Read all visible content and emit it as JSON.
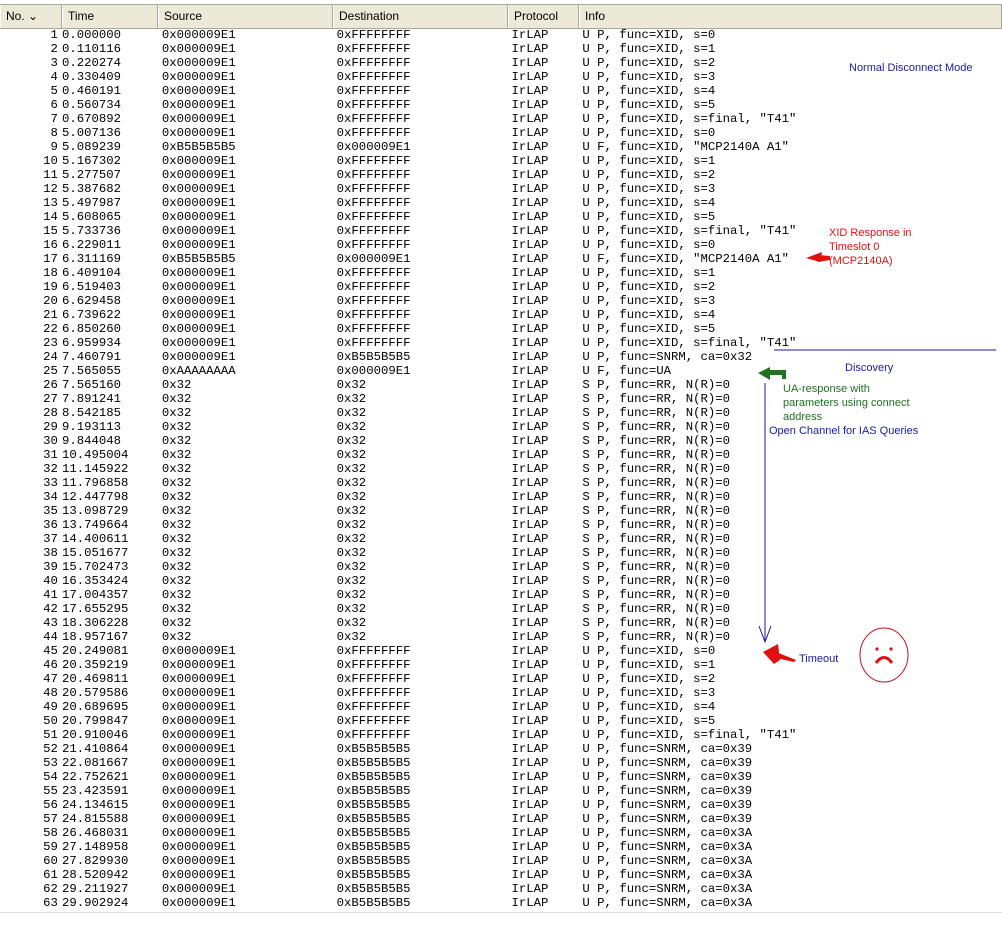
{
  "columns": [
    "No. ⌄",
    "Time",
    "Source",
    "Destination",
    "Protocol",
    "Info"
  ],
  "packets": [
    [
      "1",
      "0.000000",
      "0x000009E1",
      "0xFFFFFFFF",
      "IrLAP",
      "U P, func=XID, s=0"
    ],
    [
      "2",
      "0.110116",
      "0x000009E1",
      "0xFFFFFFFF",
      "IrLAP",
      "U P, func=XID, s=1"
    ],
    [
      "3",
      "0.220274",
      "0x000009E1",
      "0xFFFFFFFF",
      "IrLAP",
      "U P, func=XID, s=2"
    ],
    [
      "4",
      "0.330409",
      "0x000009E1",
      "0xFFFFFFFF",
      "IrLAP",
      "U P, func=XID, s=3"
    ],
    [
      "5",
      "0.460191",
      "0x000009E1",
      "0xFFFFFFFF",
      "IrLAP",
      "U P, func=XID, s=4"
    ],
    [
      "6",
      "0.560734",
      "0x000009E1",
      "0xFFFFFFFF",
      "IrLAP",
      "U P, func=XID, s=5"
    ],
    [
      "7",
      "0.670892",
      "0x000009E1",
      "0xFFFFFFFF",
      "IrLAP",
      "U P, func=XID, s=final, \"T41\""
    ],
    [
      "8",
      "5.007136",
      "0x000009E1",
      "0xFFFFFFFF",
      "IrLAP",
      "U P, func=XID, s=0"
    ],
    [
      "9",
      "5.089239",
      "0xB5B5B5B5",
      "0x000009E1",
      "IrLAP",
      "U F, func=XID, \"MCP2140A A1\""
    ],
    [
      "10",
      "5.167302",
      "0x000009E1",
      "0xFFFFFFFF",
      "IrLAP",
      "U P, func=XID, s=1"
    ],
    [
      "11",
      "5.277507",
      "0x000009E1",
      "0xFFFFFFFF",
      "IrLAP",
      "U P, func=XID, s=2"
    ],
    [
      "12",
      "5.387682",
      "0x000009E1",
      "0xFFFFFFFF",
      "IrLAP",
      "U P, func=XID, s=3"
    ],
    [
      "13",
      "5.497987",
      "0x000009E1",
      "0xFFFFFFFF",
      "IrLAP",
      "U P, func=XID, s=4"
    ],
    [
      "14",
      "5.608065",
      "0x000009E1",
      "0xFFFFFFFF",
      "IrLAP",
      "U P, func=XID, s=5"
    ],
    [
      "15",
      "5.733736",
      "0x000009E1",
      "0xFFFFFFFF",
      "IrLAP",
      "U P, func=XID, s=final, \"T41\""
    ],
    [
      "16",
      "6.229011",
      "0x000009E1",
      "0xFFFFFFFF",
      "IrLAP",
      "U P, func=XID, s=0"
    ],
    [
      "17",
      "6.311169",
      "0xB5B5B5B5",
      "0x000009E1",
      "IrLAP",
      "U F, func=XID, \"MCP2140A A1\""
    ],
    [
      "18",
      "6.409104",
      "0x000009E1",
      "0xFFFFFFFF",
      "IrLAP",
      "U P, func=XID, s=1"
    ],
    [
      "19",
      "6.519403",
      "0x000009E1",
      "0xFFFFFFFF",
      "IrLAP",
      "U P, func=XID, s=2"
    ],
    [
      "20",
      "6.629458",
      "0x000009E1",
      "0xFFFFFFFF",
      "IrLAP",
      "U P, func=XID, s=3"
    ],
    [
      "21",
      "6.739622",
      "0x000009E1",
      "0xFFFFFFFF",
      "IrLAP",
      "U P, func=XID, s=4"
    ],
    [
      "22",
      "6.850260",
      "0x000009E1",
      "0xFFFFFFFF",
      "IrLAP",
      "U P, func=XID, s=5"
    ],
    [
      "23",
      "6.959934",
      "0x000009E1",
      "0xFFFFFFFF",
      "IrLAP",
      "U P, func=XID, s=final, \"T41\""
    ],
    [
      "24",
      "7.460791",
      "0x000009E1",
      "0xB5B5B5B5",
      "IrLAP",
      "U P, func=SNRM, ca=0x32"
    ],
    [
      "25",
      "7.565055",
      "0xAAAAAAAA",
      "0x000009E1",
      "IrLAP",
      "U F, func=UA"
    ],
    [
      "26",
      "7.565160",
      "0x32",
      "0x32",
      "IrLAP",
      "S P, func=RR, N(R)=0"
    ],
    [
      "27",
      "7.891241",
      "0x32",
      "0x32",
      "IrLAP",
      "S P, func=RR, N(R)=0"
    ],
    [
      "28",
      "8.542185",
      "0x32",
      "0x32",
      "IrLAP",
      "S P, func=RR, N(R)=0"
    ],
    [
      "29",
      "9.193113",
      "0x32",
      "0x32",
      "IrLAP",
      "S P, func=RR, N(R)=0"
    ],
    [
      "30",
      "9.844048",
      "0x32",
      "0x32",
      "IrLAP",
      "S P, func=RR, N(R)=0"
    ],
    [
      "31",
      "10.495004",
      "0x32",
      "0x32",
      "IrLAP",
      "S P, func=RR, N(R)=0"
    ],
    [
      "32",
      "11.145922",
      "0x32",
      "0x32",
      "IrLAP",
      "S P, func=RR, N(R)=0"
    ],
    [
      "33",
      "11.796858",
      "0x32",
      "0x32",
      "IrLAP",
      "S P, func=RR, N(R)=0"
    ],
    [
      "34",
      "12.447798",
      "0x32",
      "0x32",
      "IrLAP",
      "S P, func=RR, N(R)=0"
    ],
    [
      "35",
      "13.098729",
      "0x32",
      "0x32",
      "IrLAP",
      "S P, func=RR, N(R)=0"
    ],
    [
      "36",
      "13.749664",
      "0x32",
      "0x32",
      "IrLAP",
      "S P, func=RR, N(R)=0"
    ],
    [
      "37",
      "14.400611",
      "0x32",
      "0x32",
      "IrLAP",
      "S P, func=RR, N(R)=0"
    ],
    [
      "38",
      "15.051677",
      "0x32",
      "0x32",
      "IrLAP",
      "S P, func=RR, N(R)=0"
    ],
    [
      "39",
      "15.702473",
      "0x32",
      "0x32",
      "IrLAP",
      "S P, func=RR, N(R)=0"
    ],
    [
      "40",
      "16.353424",
      "0x32",
      "0x32",
      "IrLAP",
      "S P, func=RR, N(R)=0"
    ],
    [
      "41",
      "17.004357",
      "0x32",
      "0x32",
      "IrLAP",
      "S P, func=RR, N(R)=0"
    ],
    [
      "42",
      "17.655295",
      "0x32",
      "0x32",
      "IrLAP",
      "S P, func=RR, N(R)=0"
    ],
    [
      "43",
      "18.306228",
      "0x32",
      "0x32",
      "IrLAP",
      "S P, func=RR, N(R)=0"
    ],
    [
      "44",
      "18.957167",
      "0x32",
      "0x32",
      "IrLAP",
      "S P, func=RR, N(R)=0"
    ],
    [
      "45",
      "20.249081",
      "0x000009E1",
      "0xFFFFFFFF",
      "IrLAP",
      "U P, func=XID, s=0"
    ],
    [
      "46",
      "20.359219",
      "0x000009E1",
      "0xFFFFFFFF",
      "IrLAP",
      "U P, func=XID, s=1"
    ],
    [
      "47",
      "20.469811",
      "0x000009E1",
      "0xFFFFFFFF",
      "IrLAP",
      "U P, func=XID, s=2"
    ],
    [
      "48",
      "20.579586",
      "0x000009E1",
      "0xFFFFFFFF",
      "IrLAP",
      "U P, func=XID, s=3"
    ],
    [
      "49",
      "20.689695",
      "0x000009E1",
      "0xFFFFFFFF",
      "IrLAP",
      "U P, func=XID, s=4"
    ],
    [
      "50",
      "20.799847",
      "0x000009E1",
      "0xFFFFFFFF",
      "IrLAP",
      "U P, func=XID, s=5"
    ],
    [
      "51",
      "20.910046",
      "0x000009E1",
      "0xFFFFFFFF",
      "IrLAP",
      "U P, func=XID, s=final, \"T41\""
    ],
    [
      "52",
      "21.410864",
      "0x000009E1",
      "0xB5B5B5B5",
      "IrLAP",
      "U P, func=SNRM, ca=0x39"
    ],
    [
      "53",
      "22.081667",
      "0x000009E1",
      "0xB5B5B5B5",
      "IrLAP",
      "U P, func=SNRM, ca=0x39"
    ],
    [
      "54",
      "22.752621",
      "0x000009E1",
      "0xB5B5B5B5",
      "IrLAP",
      "U P, func=SNRM, ca=0x39"
    ],
    [
      "55",
      "23.423591",
      "0x000009E1",
      "0xB5B5B5B5",
      "IrLAP",
      "U P, func=SNRM, ca=0x39"
    ],
    [
      "56",
      "24.134615",
      "0x000009E1",
      "0xB5B5B5B5",
      "IrLAP",
      "U P, func=SNRM, ca=0x39"
    ],
    [
      "57",
      "24.815588",
      "0x000009E1",
      "0xB5B5B5B5",
      "IrLAP",
      "U P, func=SNRM, ca=0x39"
    ],
    [
      "58",
      "26.468031",
      "0x000009E1",
      "0xB5B5B5B5",
      "IrLAP",
      "U P, func=SNRM, ca=0x3A"
    ],
    [
      "59",
      "27.148958",
      "0x000009E1",
      "0xB5B5B5B5",
      "IrLAP",
      "U P, func=SNRM, ca=0x3A"
    ],
    [
      "60",
      "27.829930",
      "0x000009E1",
      "0xB5B5B5B5",
      "IrLAP",
      "U P, func=SNRM, ca=0x3A"
    ],
    [
      "61",
      "28.520942",
      "0x000009E1",
      "0xB5B5B5B5",
      "IrLAP",
      "U P, func=SNRM, ca=0x3A"
    ],
    [
      "62",
      "29.211927",
      "0x000009E1",
      "0xB5B5B5B5",
      "IrLAP",
      "U P, func=SNRM, ca=0x3A"
    ],
    [
      "63",
      "29.902924",
      "0x000009E1",
      "0xB5B5B5B5",
      "IrLAP",
      "U P, func=SNRM, ca=0x3A"
    ]
  ],
  "annotations": {
    "normal_disconnect": "Normal Disconnect Mode",
    "xid_response": [
      "XID Response in",
      "Timeslot 0",
      "(MCP2140A)"
    ],
    "discovery": "Discovery",
    "ua_response": [
      "UA-response with",
      "parameters using connect",
      "address"
    ],
    "open_channel": "Open Channel for IAS Queries",
    "timeout": "Timeout"
  },
  "colors": {
    "blue": "#1a1aa0",
    "red": "#e01010",
    "green": "#207020"
  }
}
